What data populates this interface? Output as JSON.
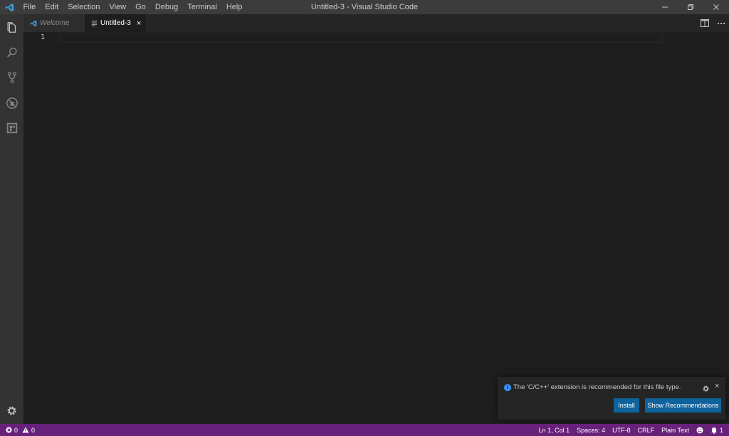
{
  "window": {
    "title": "Untitled-3 - Visual Studio Code",
    "controls": [
      "minimize-icon",
      "restore-icon",
      "close-icon"
    ]
  },
  "menu": [
    "File",
    "Edit",
    "Selection",
    "View",
    "Go",
    "Debug",
    "Terminal",
    "Help"
  ],
  "activity_bar": [
    "files-icon",
    "search-icon",
    "source-control-icon",
    "debug-icon",
    "extensions-icon",
    "gear-icon"
  ],
  "tabs": [
    {
      "label": "Welcome",
      "active": false,
      "icon": "vscode-icon"
    },
    {
      "label": "Untitled-3",
      "active": true,
      "icon": "text-file-icon",
      "close": "×"
    }
  ],
  "editor": {
    "line_numbers": [
      "1"
    ],
    "content": ""
  },
  "notification": {
    "message": "The 'C/C++' extension is recommended for this file type.",
    "icon": "info-icon",
    "info_glyph": "i",
    "close": "×",
    "install_label": "Install",
    "show_label": "Show Recommendations"
  },
  "status": {
    "errors": "0",
    "warnings": "0",
    "position": "Ln 1, Col 1",
    "spaces": "Spaces: 4",
    "encoding": "UTF-8",
    "eol": "CRLF",
    "language": "Plain Text",
    "notifications": "1"
  },
  "colors": {
    "statusbar": "#68217a",
    "button": "#0e639c",
    "editor_bg": "#1e1e1e",
    "titlebar": "#3c3c3c",
    "activitybar": "#333333"
  }
}
